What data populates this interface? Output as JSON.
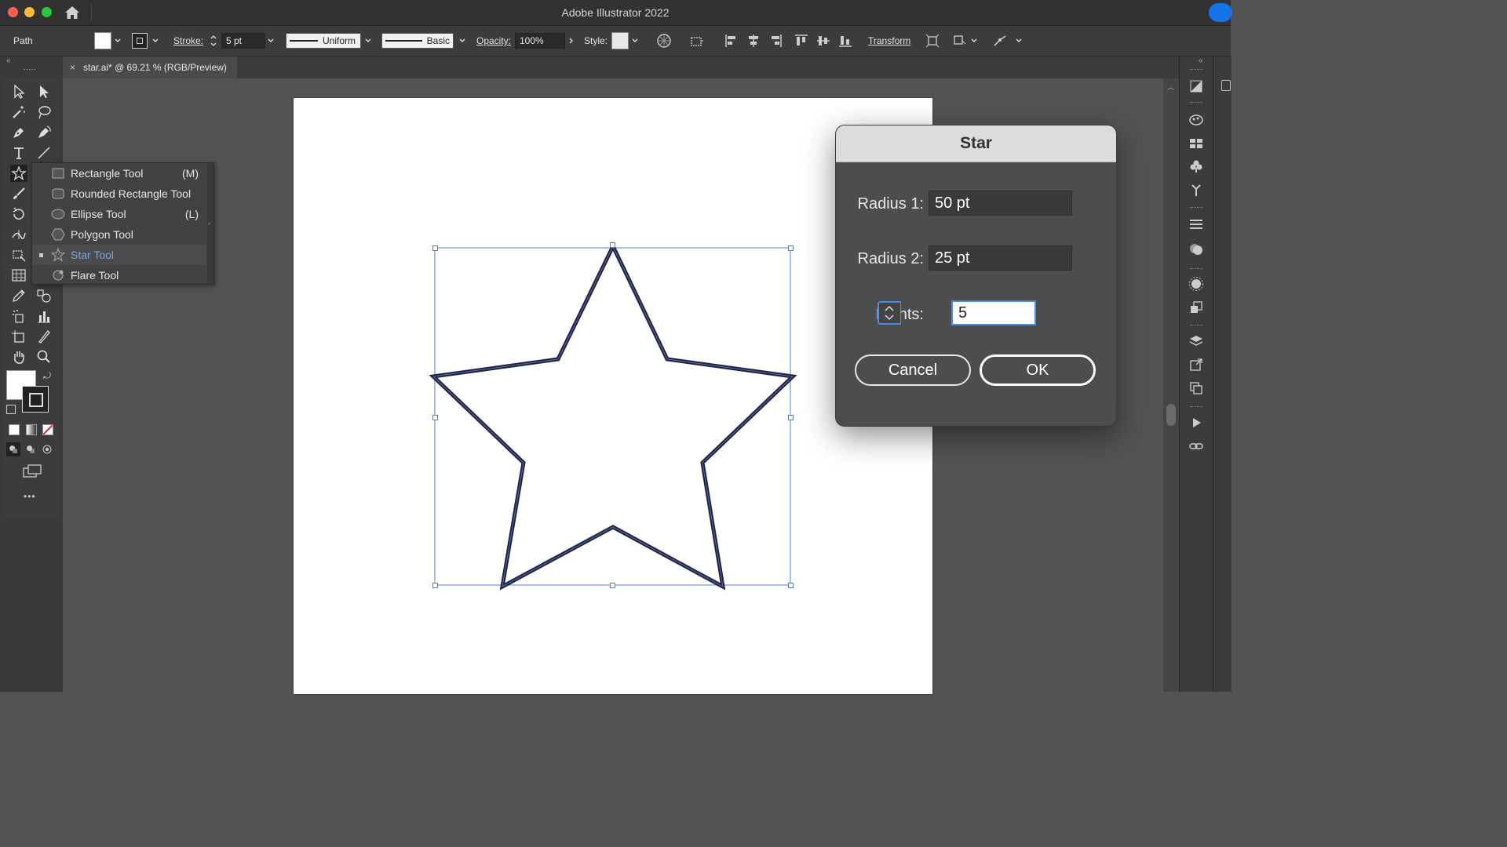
{
  "app": {
    "title": "Adobe Illustrator 2022"
  },
  "control_bar": {
    "selection_label": "Path",
    "stroke_label": "Stroke:",
    "stroke_value": "5 pt",
    "profile_value": "Uniform",
    "brush_value": "Basic",
    "opacity_label": "Opacity:",
    "opacity_value": "100%",
    "style_label": "Style:",
    "transform_label": "Transform"
  },
  "document_tab": {
    "title": "star.ai* @ 69.21 % (RGB/Preview)",
    "close": "×"
  },
  "flyout": {
    "items": [
      {
        "label": "Rectangle Tool",
        "shortcut": "(M)",
        "icon": "rectangle-icon"
      },
      {
        "label": "Rounded Rectangle Tool",
        "shortcut": "",
        "icon": "rounded-rectangle-icon"
      },
      {
        "label": "Ellipse Tool",
        "shortcut": "(L)",
        "icon": "ellipse-icon"
      },
      {
        "label": "Polygon Tool",
        "shortcut": "",
        "icon": "polygon-icon"
      },
      {
        "label": "Star Tool",
        "shortcut": "",
        "icon": "star-icon",
        "active": true
      },
      {
        "label": "Flare Tool",
        "shortcut": "",
        "icon": "flare-icon"
      }
    ]
  },
  "dialog": {
    "title": "Star",
    "radius1_label": "Radius 1:",
    "radius1_value": "50 pt",
    "radius2_label": "Radius 2:",
    "radius2_value": "25 pt",
    "points_label": "Points:",
    "points_value": "5",
    "cancel_label": "Cancel",
    "ok_label": "OK"
  },
  "toolbar": {
    "more_label": "•••"
  },
  "colors": {
    "accent": "#4a8de6",
    "star_stroke": "#1f2240",
    "selection": "#4a7fd6"
  }
}
